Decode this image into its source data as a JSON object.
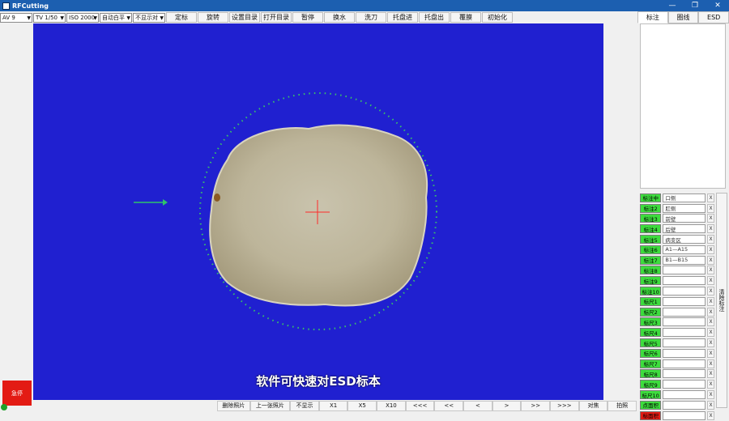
{
  "window": {
    "title": "RFCutting",
    "controls": [
      "—",
      "❐",
      "✕"
    ]
  },
  "toolbar": {
    "selects": [
      {
        "name": "av-select",
        "value": "AV 9"
      },
      {
        "name": "tv-select",
        "value": "TV 1/50"
      },
      {
        "name": "iso-select",
        "value": "ISO 2000"
      },
      {
        "name": "wb-select",
        "value": "自动白平"
      },
      {
        "name": "display-select",
        "value": "不显示对"
      }
    ],
    "buttons": [
      "定标",
      "旋转",
      "设置目录",
      "打开目录",
      "暂停",
      "换水",
      "洗刀",
      "托盘进",
      "托盘出",
      "覆膜",
      "初始化"
    ]
  },
  "left": {
    "stop_label": "急停"
  },
  "subtitle": "软件可快速对ESD标本",
  "bottombar": {
    "buttons": [
      "删除照片",
      "上一张照片",
      "不显示",
      "X1",
      "X5",
      "X10",
      "<<<",
      "<<",
      "<",
      ">",
      ">>",
      ">>>",
      "对焦",
      "拍照"
    ]
  },
  "side": {
    "tabs": [
      "标注",
      "圈线",
      "ESD"
    ],
    "clear_label": "清除标注",
    "rows": [
      {
        "label": "标注中",
        "value": "口侧",
        "color": "#3ddc3d"
      },
      {
        "label": "标注2",
        "value": "肛侧",
        "color": "#3ddc3d"
      },
      {
        "label": "标注3",
        "value": "前壁",
        "color": "#3ddc3d"
      },
      {
        "label": "标注4",
        "value": "后壁",
        "color": "#3ddc3d"
      },
      {
        "label": "标注5",
        "value": "病变区",
        "color": "#3ddc3d"
      },
      {
        "label": "标注6",
        "value": "A1—A15",
        "color": "#3ddc3d"
      },
      {
        "label": "标注7",
        "value": "B1—B15",
        "color": "#3ddc3d"
      },
      {
        "label": "标注8",
        "value": "",
        "color": "#3ddc3d"
      },
      {
        "label": "标注9",
        "value": "",
        "color": "#3ddc3d"
      },
      {
        "label": "标注10",
        "value": "",
        "color": "#3ddc3d"
      },
      {
        "label": "标尺1",
        "value": "",
        "color": "#3ddc3d"
      },
      {
        "label": "标尺2",
        "value": "",
        "color": "#3ddc3d"
      },
      {
        "label": "标尺3",
        "value": "",
        "color": "#3ddc3d"
      },
      {
        "label": "标尺4",
        "value": "",
        "color": "#3ddc3d"
      },
      {
        "label": "标尺5",
        "value": "",
        "color": "#3ddc3d"
      },
      {
        "label": "标尺6",
        "value": "",
        "color": "#3ddc3d"
      },
      {
        "label": "标尺7",
        "value": "",
        "color": "#3ddc3d"
      },
      {
        "label": "标尺8",
        "value": "",
        "color": "#3ddc3d"
      },
      {
        "label": "标尺9",
        "value": "",
        "color": "#3ddc3d"
      },
      {
        "label": "标尺10",
        "value": "",
        "color": "#3ddc3d"
      },
      {
        "label": "点面积",
        "value": "",
        "color": "#3ddc3d"
      },
      {
        "label": "标面积",
        "value": "",
        "color": "#e31b14"
      }
    ],
    "row_x": "X"
  }
}
